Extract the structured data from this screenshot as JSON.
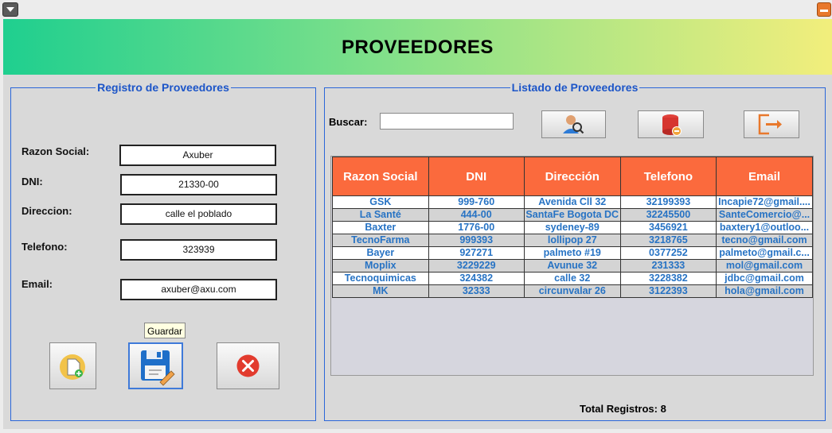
{
  "window": {},
  "header": {
    "title": "PROVEEDORES"
  },
  "form": {
    "legend": "Registro de Proveedores",
    "fields": [
      {
        "label": "Razon Social:",
        "value": "Axuber"
      },
      {
        "label": "DNI:",
        "value": "21330-00"
      },
      {
        "label": "Direccion:",
        "value": "calle el poblado"
      },
      {
        "label": "Telefono:",
        "value": "323939"
      },
      {
        "label": "Email:",
        "value": "axuber@axu.com"
      }
    ],
    "buttons": {
      "new_icon": "new-document-icon",
      "save_icon": "floppy-save-icon",
      "cancel_icon": "red-x-icon"
    },
    "tooltip": "Guardar"
  },
  "list": {
    "legend": "Listado de Proveedores",
    "search_label": "Buscar:",
    "search_value": "",
    "buttons": {
      "search_icon": "user-search-icon",
      "delete_icon": "database-delete-icon",
      "exit_icon": "exit-door-icon"
    },
    "columns": [
      "Razon Social",
      "DNI",
      "Dirección",
      "Telefono",
      "Email"
    ],
    "rows": [
      [
        "GSK",
        "999-760",
        "Avenida Cll 32",
        "32199393",
        "Incapie72@gmail...."
      ],
      [
        "La Santé",
        "444-00",
        "SantaFe Bogota DC",
        "32245500",
        "SanteComercio@..."
      ],
      [
        "Baxter",
        "1776-00",
        "sydeney-89",
        "3456921",
        "baxtery1@outloo..."
      ],
      [
        "TecnoFarma",
        "999393",
        "lollipop 27",
        "3218765",
        "tecno@gmail.com"
      ],
      [
        "Bayer",
        "927271",
        "palmeto #19",
        "0377252",
        "palmeto@gmail.c..."
      ],
      [
        "Moplix",
        "3229229",
        "Avunue 32",
        "231333",
        "mol@gmail.com"
      ],
      [
        "Tecnoquimicas",
        "324382",
        "calle 32",
        "3228382",
        "jdbc@gmail.com"
      ],
      [
        "MK",
        "32333",
        "circunvalar 26",
        "3122393",
        "hola@gmail.com"
      ]
    ],
    "total_label": "Total Registros: 8"
  },
  "colors": {
    "accent": "#2a66d9",
    "table_header": "#fb6a3d",
    "cell_text": "#2773c4"
  }
}
